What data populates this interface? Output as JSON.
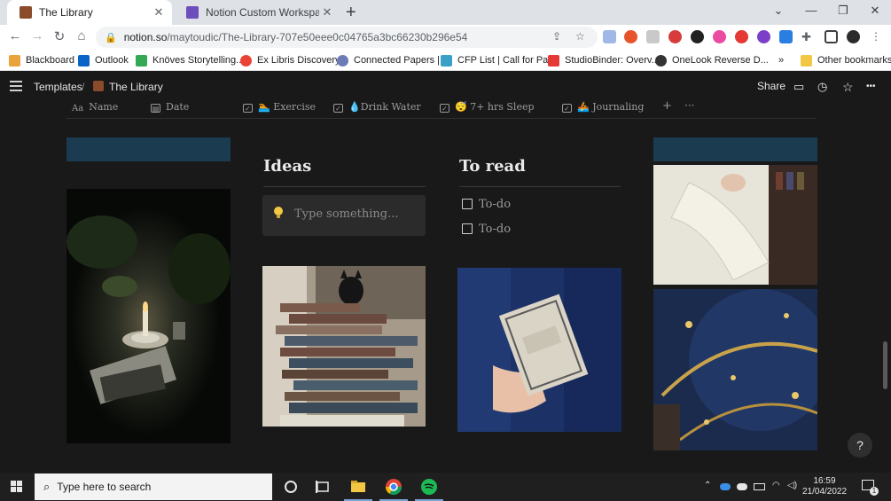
{
  "browser": {
    "tabs": [
      {
        "title": "The Library",
        "active": true,
        "favicon": "book-icon"
      },
      {
        "title": "Notion Custom Workspace Ques",
        "active": false,
        "favicon": "notion-form-icon"
      }
    ],
    "close_glyph": "✕",
    "new_tab_glyph": "+",
    "window": {
      "down": "⌄",
      "minimize": "—",
      "restore": "❐",
      "close": "✕"
    },
    "nav": {
      "back": "←",
      "forward": "→",
      "reload": "↻",
      "home": "⌂"
    },
    "url_host": "notion.so",
    "url_path": "/maytoudic/The-Library-707e50eee0c04765a3bc66230b296e54",
    "bookmarks": [
      {
        "label": "Blackboard",
        "color": "#e8a33d"
      },
      {
        "label": "Outlook",
        "color": "#0a64c8"
      },
      {
        "label": "Knöves Storytelling...",
        "color": "#34a853"
      },
      {
        "label": "Ex Libris Discovery",
        "color": "#ea4335"
      },
      {
        "label": "Connected Papers |...",
        "color": "#6b7bb8"
      },
      {
        "label": "CFP List | Call for Pa...",
        "color": "#3aa0c8"
      },
      {
        "label": "StudioBinder: Overv...",
        "color": "#e53935"
      },
      {
        "label": "OneLook Reverse D...",
        "color": "#333333"
      }
    ],
    "bookmarks_more": "»",
    "other_bookmarks": "Other bookmarks"
  },
  "notion": {
    "breadcrumb_root": "Templates",
    "breadcrumb_sep": "/",
    "page_title": "The Library",
    "share_label": "Share",
    "more_glyph": "•••",
    "properties": [
      {
        "label": "Name",
        "icon": "Aa"
      },
      {
        "label": "Date",
        "icon": "▤"
      },
      {
        "label": "🏊 Exercise",
        "icon": "✓"
      },
      {
        "label": "💧Drink Water",
        "icon": "✓"
      },
      {
        "label": "😴 7+ hrs Sleep",
        "icon": "✓"
      },
      {
        "label": "🚣 Journaling",
        "icon": "✓"
      }
    ],
    "add_prop_glyph": "+",
    "prop_more_glyph": "···",
    "ideas": {
      "heading": "Ideas",
      "placeholder": "Type something..."
    },
    "to_read": {
      "heading": "To read",
      "items": [
        "To-do",
        "To-do"
      ]
    },
    "help_glyph": "?",
    "banner_color": "#1b3b50"
  },
  "taskbar": {
    "search_placeholder": "Type here to search",
    "time": "16:59",
    "date": "21/04/2022",
    "notification_count": "1"
  }
}
